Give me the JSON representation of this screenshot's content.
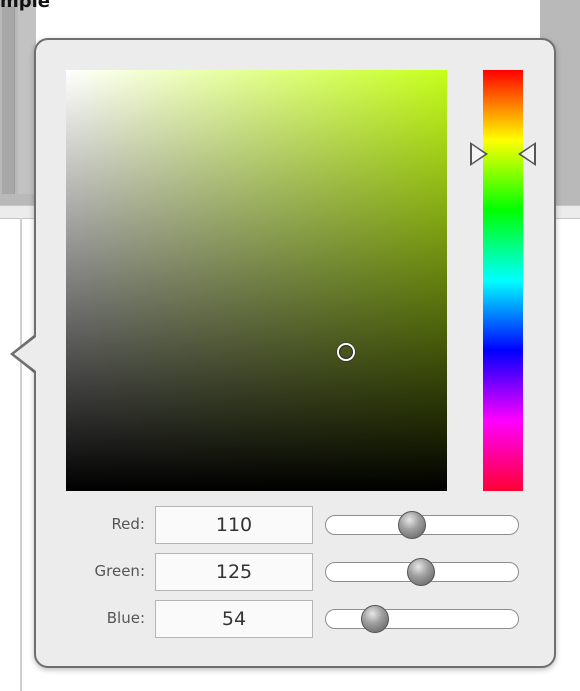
{
  "header": {
    "title": "mple"
  },
  "picker": {
    "base_hue_color": "#c6ff1a",
    "hue_fraction": 0.2,
    "selected_color": "#6e7d36",
    "channels": [
      {
        "label": "Red:",
        "value": "110",
        "slider_fraction": 0.431
      },
      {
        "label": "Green:",
        "value": "125",
        "slider_fraction": 0.49
      },
      {
        "label": "Blue:",
        "value": "54",
        "slider_fraction": 0.212
      }
    ]
  }
}
